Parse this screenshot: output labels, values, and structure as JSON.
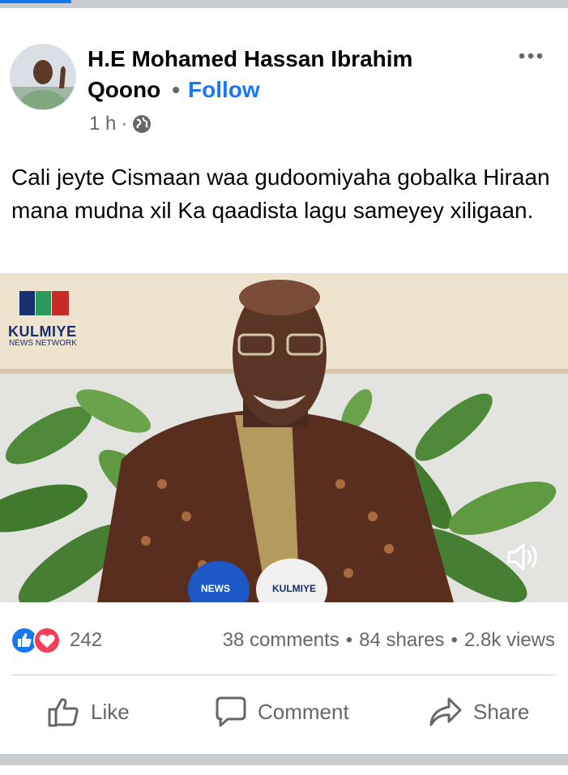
{
  "post": {
    "author": "H.E Mohamed Hassan Ibrahim Qoono",
    "separator": "•",
    "follow_label": "Follow",
    "time": "1 h",
    "meta_dot": "·",
    "privacy_icon": "globe-icon",
    "more_icon": "more-options-icon",
    "text": "Cali jeyte Cismaan waa gudoomiyaha gobalka Hiraan mana mudna xil Ka qaadista lagu sameyey xiligaan."
  },
  "video": {
    "brand_name": "KULMIYE",
    "brand_sub": "NEWS NETWORK",
    "mic_left_label": "NEWS",
    "mic_right_label": "KULMIYE",
    "volume_icon": "volume-icon"
  },
  "stats": {
    "reaction_icons": [
      "like-reaction-icon",
      "love-reaction-icon"
    ],
    "reaction_count": "242",
    "comments": "38 comments",
    "shares": "84 shares",
    "views": "2.8k views",
    "sep": "•"
  },
  "actions": {
    "like_label": "Like",
    "comment_label": "Comment",
    "share_label": "Share"
  },
  "colors": {
    "accent": "#1877f2",
    "secondary_text": "#65676b",
    "love": "#f33e58"
  }
}
